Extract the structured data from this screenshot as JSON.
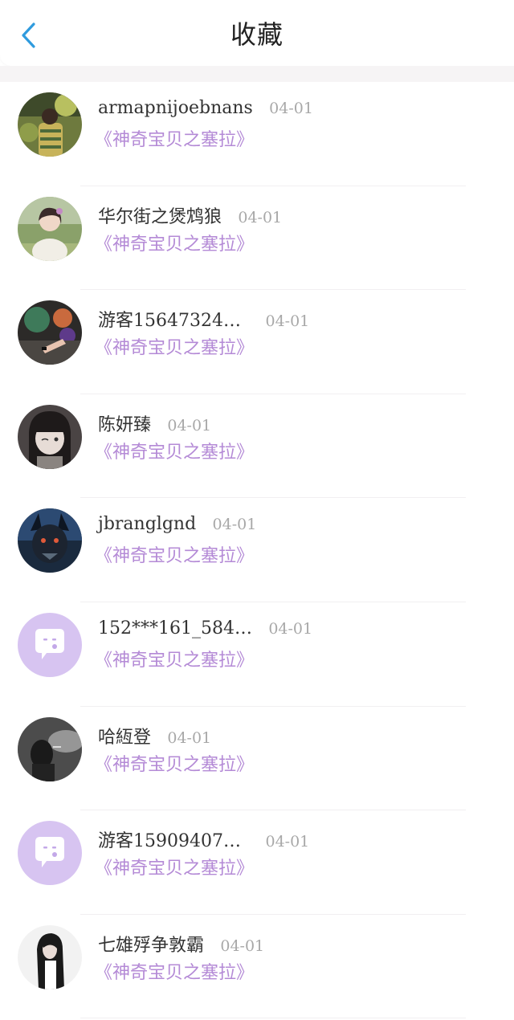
{
  "header": {
    "title": "收藏",
    "back_icon": "chevron-left-icon",
    "accent_color": "#2f9bde"
  },
  "colors": {
    "link": "#b48ad6",
    "date": "#a8a8a8",
    "default_avatar_bg": "#d7c4f1"
  },
  "items": [
    {
      "name": "armapnijoebnans",
      "date": "04-01",
      "work": "《神奇宝贝之塞拉》",
      "avatar": "photo"
    },
    {
      "name": "华尔街之煲鸩狼",
      "date": "04-01",
      "work": "《神奇宝贝之塞拉》",
      "avatar": "photo"
    },
    {
      "name": "游客15647324…",
      "date": "04-01",
      "work": "《神奇宝贝之塞拉》",
      "avatar": "photo"
    },
    {
      "name": "陈妍臻",
      "date": "04-01",
      "work": "《神奇宝贝之塞拉》",
      "avatar": "photo"
    },
    {
      "name": "jbranglgnd",
      "date": "04-01",
      "work": "《神奇宝贝之塞拉》",
      "avatar": "photo"
    },
    {
      "name": "152***161_584…",
      "date": "04-01",
      "work": "《神奇宝贝之塞拉》",
      "avatar": "default"
    },
    {
      "name": "哈絚登",
      "date": "04-01",
      "work": "《神奇宝贝之塞拉》",
      "avatar": "photo"
    },
    {
      "name": "游客15909407…",
      "date": "04-01",
      "work": "《神奇宝贝之塞拉》",
      "avatar": "default"
    },
    {
      "name": "七雄殍争敦霸",
      "date": "04-01",
      "work": "《神奇宝贝之塞拉》",
      "avatar": "photo"
    }
  ]
}
